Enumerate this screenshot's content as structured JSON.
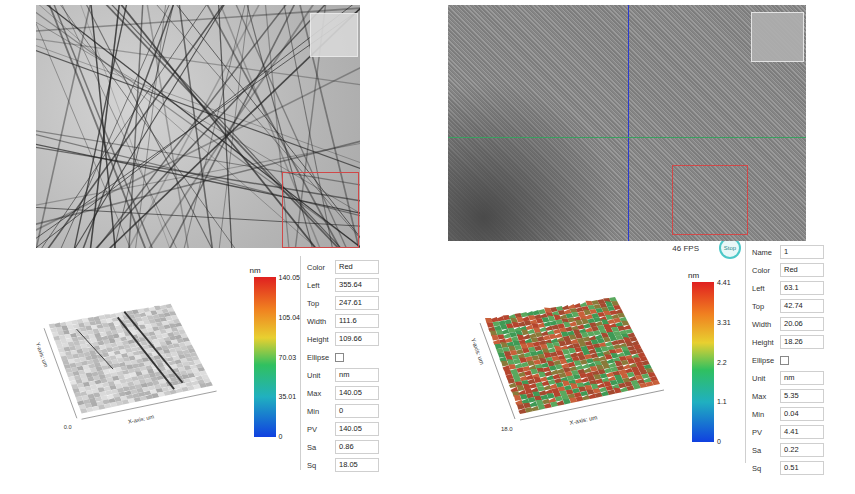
{
  "views": [
    {
      "image": {
        "kind": "fibers",
        "crosshair": false
      },
      "plot": {
        "kind": "gray",
        "axis_labels": [
          "Y-axis: um",
          "X-axis: um",
          "0.0"
        ]
      },
      "colorbar": {
        "unit": "nm",
        "ticks": [
          "140.05",
          "105.04",
          "70.03",
          "35.01",
          "0"
        ]
      },
      "properties": [
        {
          "label": "Color",
          "value": "Red",
          "kind": "field"
        },
        {
          "label": "Left",
          "value": "355.64",
          "kind": "field"
        },
        {
          "label": "Top",
          "value": "247.61",
          "kind": "field"
        },
        {
          "label": "Width",
          "value": "111.6",
          "kind": "field"
        },
        {
          "label": "Height",
          "value": "109.66",
          "kind": "field"
        },
        {
          "label": "Ellipse",
          "kind": "checkbox",
          "checked": false
        },
        {
          "label": "Unit",
          "value": "nm",
          "kind": "field"
        },
        {
          "label": "Max",
          "value": "140.05",
          "kind": "field"
        },
        {
          "label": "Min",
          "value": "0",
          "kind": "field"
        },
        {
          "label": "PV",
          "value": "140.05",
          "kind": "field"
        },
        {
          "label": "Sa",
          "value": "0.86",
          "kind": "field"
        },
        {
          "label": "Sq",
          "value": "18.05",
          "kind": "field"
        }
      ]
    },
    {
      "image": {
        "kind": "texture",
        "crosshair": true
      },
      "status": {
        "fps": "46 FPS",
        "button": "Stop"
      },
      "plot": {
        "kind": "heat",
        "axis_labels": [
          "Y-axis: um",
          "X-axis: um",
          "18.0"
        ]
      },
      "colorbar": {
        "unit": "nm",
        "ticks": [
          "4.41",
          "3.31",
          "2.2",
          "1.1",
          "0"
        ]
      },
      "properties": [
        {
          "label": "Name",
          "value": "1",
          "kind": "field"
        },
        {
          "label": "Color",
          "value": "Red",
          "kind": "field"
        },
        {
          "label": "Left",
          "value": "63.1",
          "kind": "field"
        },
        {
          "label": "Top",
          "value": "42.74",
          "kind": "field"
        },
        {
          "label": "Width",
          "value": "20.06",
          "kind": "field"
        },
        {
          "label": "Height",
          "value": "18.26",
          "kind": "field"
        },
        {
          "label": "Ellipse",
          "kind": "checkbox",
          "checked": false
        },
        {
          "label": "Unit",
          "value": "nm",
          "kind": "field"
        },
        {
          "label": "Max",
          "value": "5.35",
          "kind": "field"
        },
        {
          "label": "Min",
          "value": "0.04",
          "kind": "field"
        },
        {
          "label": "PV",
          "value": "4.41",
          "kind": "field"
        },
        {
          "label": "Sa",
          "value": "0.22",
          "kind": "field"
        },
        {
          "label": "Sq",
          "value": "0.51",
          "kind": "field"
        }
      ]
    }
  ]
}
